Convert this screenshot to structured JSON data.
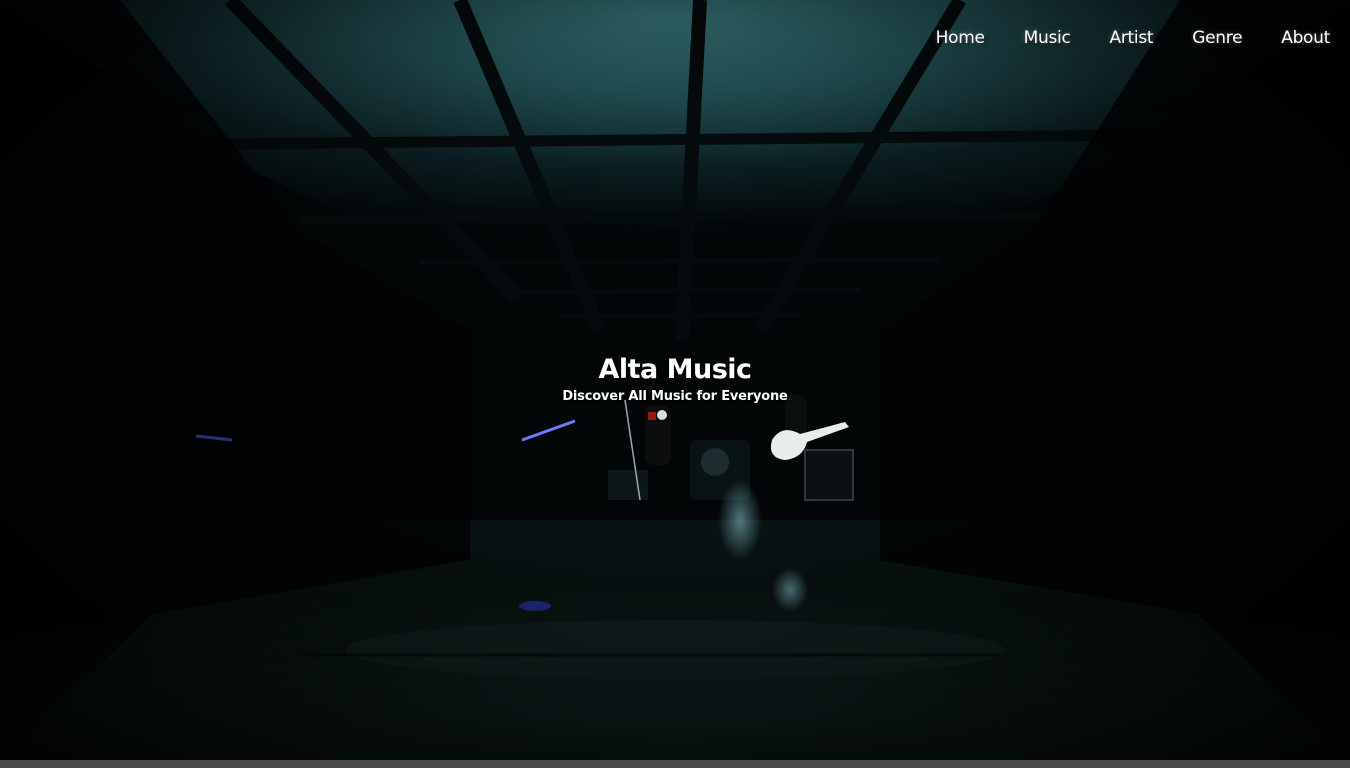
{
  "nav": {
    "items": [
      {
        "label": "Home"
      },
      {
        "label": "Music"
      },
      {
        "label": "Artist"
      },
      {
        "label": "Genre"
      },
      {
        "label": "About"
      }
    ]
  },
  "hero": {
    "title": "Alta Music",
    "subtitle": "Discover All Music for Everyone"
  },
  "colors": {
    "background": "#020607",
    "ceiling_glow": "#2f6a6e",
    "text": "#ffffff",
    "bottom_bar": "#4a4a4a"
  }
}
